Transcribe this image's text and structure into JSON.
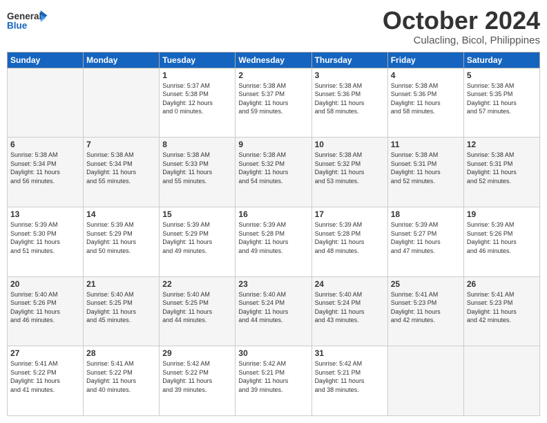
{
  "header": {
    "logo_general": "General",
    "logo_blue": "Blue",
    "month": "October 2024",
    "location": "Culacling, Bicol, Philippines"
  },
  "weekdays": [
    "Sunday",
    "Monday",
    "Tuesday",
    "Wednesday",
    "Thursday",
    "Friday",
    "Saturday"
  ],
  "rows": [
    [
      {
        "day": "",
        "info": ""
      },
      {
        "day": "",
        "info": ""
      },
      {
        "day": "1",
        "info": "Sunrise: 5:37 AM\nSunset: 5:38 PM\nDaylight: 12 hours\nand 0 minutes."
      },
      {
        "day": "2",
        "info": "Sunrise: 5:38 AM\nSunset: 5:37 PM\nDaylight: 11 hours\nand 59 minutes."
      },
      {
        "day": "3",
        "info": "Sunrise: 5:38 AM\nSunset: 5:36 PM\nDaylight: 11 hours\nand 58 minutes."
      },
      {
        "day": "4",
        "info": "Sunrise: 5:38 AM\nSunset: 5:36 PM\nDaylight: 11 hours\nand 58 minutes."
      },
      {
        "day": "5",
        "info": "Sunrise: 5:38 AM\nSunset: 5:35 PM\nDaylight: 11 hours\nand 57 minutes."
      }
    ],
    [
      {
        "day": "6",
        "info": "Sunrise: 5:38 AM\nSunset: 5:34 PM\nDaylight: 11 hours\nand 56 minutes."
      },
      {
        "day": "7",
        "info": "Sunrise: 5:38 AM\nSunset: 5:34 PM\nDaylight: 11 hours\nand 55 minutes."
      },
      {
        "day": "8",
        "info": "Sunrise: 5:38 AM\nSunset: 5:33 PM\nDaylight: 11 hours\nand 55 minutes."
      },
      {
        "day": "9",
        "info": "Sunrise: 5:38 AM\nSunset: 5:32 PM\nDaylight: 11 hours\nand 54 minutes."
      },
      {
        "day": "10",
        "info": "Sunrise: 5:38 AM\nSunset: 5:32 PM\nDaylight: 11 hours\nand 53 minutes."
      },
      {
        "day": "11",
        "info": "Sunrise: 5:38 AM\nSunset: 5:31 PM\nDaylight: 11 hours\nand 52 minutes."
      },
      {
        "day": "12",
        "info": "Sunrise: 5:38 AM\nSunset: 5:31 PM\nDaylight: 11 hours\nand 52 minutes."
      }
    ],
    [
      {
        "day": "13",
        "info": "Sunrise: 5:39 AM\nSunset: 5:30 PM\nDaylight: 11 hours\nand 51 minutes."
      },
      {
        "day": "14",
        "info": "Sunrise: 5:39 AM\nSunset: 5:29 PM\nDaylight: 11 hours\nand 50 minutes."
      },
      {
        "day": "15",
        "info": "Sunrise: 5:39 AM\nSunset: 5:29 PM\nDaylight: 11 hours\nand 49 minutes."
      },
      {
        "day": "16",
        "info": "Sunrise: 5:39 AM\nSunset: 5:28 PM\nDaylight: 11 hours\nand 49 minutes."
      },
      {
        "day": "17",
        "info": "Sunrise: 5:39 AM\nSunset: 5:28 PM\nDaylight: 11 hours\nand 48 minutes."
      },
      {
        "day": "18",
        "info": "Sunrise: 5:39 AM\nSunset: 5:27 PM\nDaylight: 11 hours\nand 47 minutes."
      },
      {
        "day": "19",
        "info": "Sunrise: 5:39 AM\nSunset: 5:26 PM\nDaylight: 11 hours\nand 46 minutes."
      }
    ],
    [
      {
        "day": "20",
        "info": "Sunrise: 5:40 AM\nSunset: 5:26 PM\nDaylight: 11 hours\nand 46 minutes."
      },
      {
        "day": "21",
        "info": "Sunrise: 5:40 AM\nSunset: 5:25 PM\nDaylight: 11 hours\nand 45 minutes."
      },
      {
        "day": "22",
        "info": "Sunrise: 5:40 AM\nSunset: 5:25 PM\nDaylight: 11 hours\nand 44 minutes."
      },
      {
        "day": "23",
        "info": "Sunrise: 5:40 AM\nSunset: 5:24 PM\nDaylight: 11 hours\nand 44 minutes."
      },
      {
        "day": "24",
        "info": "Sunrise: 5:40 AM\nSunset: 5:24 PM\nDaylight: 11 hours\nand 43 minutes."
      },
      {
        "day": "25",
        "info": "Sunrise: 5:41 AM\nSunset: 5:23 PM\nDaylight: 11 hours\nand 42 minutes."
      },
      {
        "day": "26",
        "info": "Sunrise: 5:41 AM\nSunset: 5:23 PM\nDaylight: 11 hours\nand 42 minutes."
      }
    ],
    [
      {
        "day": "27",
        "info": "Sunrise: 5:41 AM\nSunset: 5:22 PM\nDaylight: 11 hours\nand 41 minutes."
      },
      {
        "day": "28",
        "info": "Sunrise: 5:41 AM\nSunset: 5:22 PM\nDaylight: 11 hours\nand 40 minutes."
      },
      {
        "day": "29",
        "info": "Sunrise: 5:42 AM\nSunset: 5:22 PM\nDaylight: 11 hours\nand 39 minutes."
      },
      {
        "day": "30",
        "info": "Sunrise: 5:42 AM\nSunset: 5:21 PM\nDaylight: 11 hours\nand 39 minutes."
      },
      {
        "day": "31",
        "info": "Sunrise: 5:42 AM\nSunset: 5:21 PM\nDaylight: 11 hours\nand 38 minutes."
      },
      {
        "day": "",
        "info": ""
      },
      {
        "day": "",
        "info": ""
      }
    ]
  ]
}
